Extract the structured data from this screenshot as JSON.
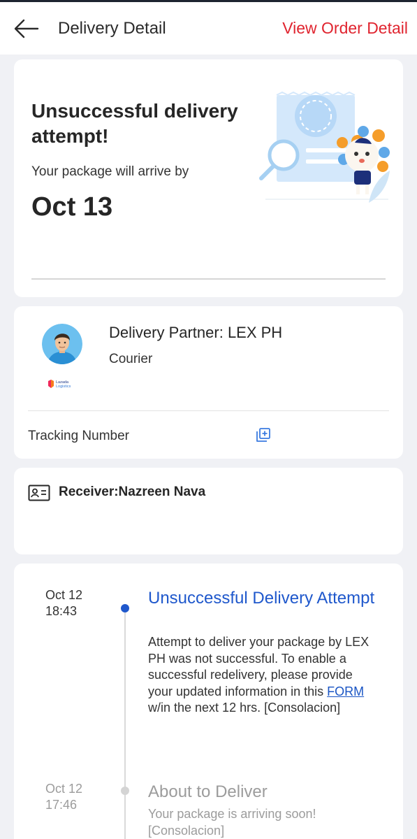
{
  "header": {
    "title": "Delivery Detail",
    "link": "View Order Detail"
  },
  "status": {
    "title": "Unsuccessful delivery attempt!",
    "subtitle": "Your package will arrive by",
    "date": "Oct 13"
  },
  "partner": {
    "name": "Delivery Partner: LEX PH",
    "role": "Courier",
    "logo_line1": "Lazada",
    "logo_line2": "Logistics",
    "tracking_label": "Tracking Number"
  },
  "receiver": {
    "text": "Receiver:Nazreen Nava"
  },
  "timeline": [
    {
      "date": "Oct 12",
      "time": "18:43",
      "title": "Unsuccessful Delivery Attempt",
      "desc_before": "Attempt to deliver your package by LEX PH was not successful. To enable a successful redelivery, please provide your updated information in this ",
      "link": "FORM",
      "desc_after": " w/in the next 12 hrs. [Consolacion]"
    },
    {
      "date": "Oct 12",
      "time": "17:46",
      "title": "About to Deliver",
      "desc": "Your package is arriving soon! [Consolacion]"
    }
  ],
  "colors": {
    "brand_red": "#e0242f",
    "active_blue": "#1f58cc",
    "muted_gray": "#9c9c9c"
  }
}
